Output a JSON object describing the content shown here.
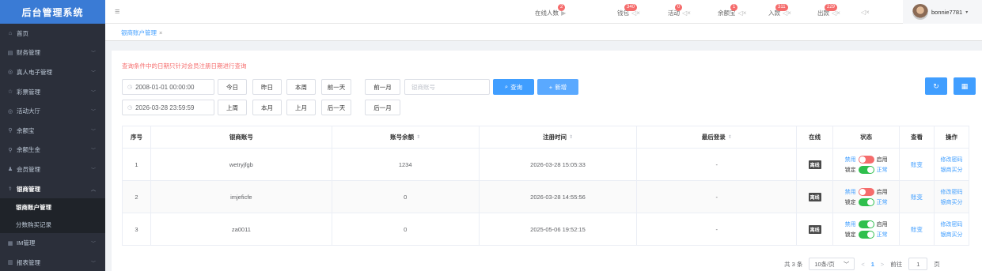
{
  "app": {
    "title": "后台管理系统"
  },
  "sidebar": {
    "items": [
      {
        "label": "首页",
        "icon": "home-icon",
        "glyph": "⌂"
      },
      {
        "label": "财务管理",
        "icon": "finance-icon",
        "glyph": "▤",
        "arrow": "﹀"
      },
      {
        "label": "真人电子管理",
        "icon": "casino-icon",
        "glyph": "◎",
        "arrow": "﹀"
      },
      {
        "label": "彩票管理",
        "icon": "star-icon",
        "glyph": "☆",
        "arrow": "﹀"
      },
      {
        "label": "活动大厅",
        "icon": "activity-icon",
        "glyph": "◎",
        "arrow": "﹀"
      },
      {
        "label": "余额宝",
        "icon": "location-icon",
        "glyph": "⚲",
        "arrow": "﹀"
      },
      {
        "label": "余额生金",
        "icon": "location-icon",
        "glyph": "⚲",
        "arrow": "﹀"
      },
      {
        "label": "会员管理",
        "icon": "user-icon",
        "glyph": "♟",
        "arrow": "﹀"
      },
      {
        "label": "银商管理",
        "icon": "merchant-icon",
        "glyph": "⚕",
        "arrow": "︿"
      }
    ],
    "subitems": [
      {
        "label": "银商账户管理"
      },
      {
        "label": "分数购买记录"
      }
    ],
    "items_after": [
      {
        "label": "IM管理",
        "icon": "im-icon",
        "glyph": "▦",
        "arrow": "﹀"
      },
      {
        "label": "报表管理",
        "icon": "report-icon",
        "glyph": "▥",
        "arrow": "﹀"
      }
    ]
  },
  "topbar": {
    "hamburger": "≡",
    "items": [
      {
        "label": "在线人数",
        "badge": "2",
        "suffix": "▶"
      },
      {
        "label": "钱包",
        "badge": "340",
        "suffix": "◁×"
      },
      {
        "label": "活动",
        "badge": "0",
        "suffix": "◁×"
      },
      {
        "label": "余额宝",
        "badge": "1",
        "suffix": "◁×"
      },
      {
        "label": "入款",
        "badge": "311",
        "suffix": "◁×"
      },
      {
        "label": "出款",
        "badge": "229",
        "suffix": "◁×"
      },
      {
        "label": "",
        "badge": "",
        "suffix": "◁×"
      }
    ],
    "user": {
      "name": "bonnie7781",
      "caret": "▾"
    }
  },
  "tabs": [
    {
      "label": "银商账户管理",
      "close": "×"
    }
  ],
  "filters": {
    "hint": "查询条件中的日期只针对会员注册日期进行查询",
    "start_date": "2008-01-01 00:00:00",
    "end_date": "2026-03-28 23:59:59",
    "row1_buttons": [
      "今日",
      "昨日",
      "本周",
      "前一天",
      "前一月"
    ],
    "row2_buttons": [
      "上周",
      "本月",
      "上月",
      "后一天",
      "后一月"
    ],
    "account_placeholder": "银商账号",
    "search_label": "查询",
    "add_label": "新增",
    "clock_glyph": "◷",
    "search_glyph": "⌕",
    "add_glyph": "+",
    "refresh_glyph": "↻",
    "grid_glyph": "▦"
  },
  "table": {
    "headers": [
      "序号",
      "银商账号",
      "账号余额",
      "注册时间",
      "最后登录",
      "在线",
      "状态",
      "查看",
      "操作"
    ],
    "sort_glyph": "⇕",
    "rows": [
      {
        "index": "1",
        "account": "wetryjfgb",
        "balance": "1234",
        "registered": "2026-03-28 15:05:33",
        "last_login": "-",
        "online": "离线",
        "ban_on": false,
        "lock_on": true,
        "view": "账变",
        "op1": "修改密码",
        "op2": "银商买分"
      },
      {
        "index": "2",
        "account": "imjeficfe",
        "balance": "0",
        "registered": "2026-03-28 14:55:56",
        "last_login": "-",
        "online": "离线",
        "ban_on": false,
        "lock_on": true,
        "view": "账变",
        "op1": "修改密码",
        "op2": "银商买分"
      },
      {
        "index": "3",
        "account": "za0011",
        "balance": "0",
        "registered": "2025-05-06 19:52:15",
        "last_login": "-",
        "online": "离线",
        "ban_on": true,
        "lock_on": true,
        "view": "账变",
        "op1": "修改密码",
        "op2": "银商买分"
      }
    ],
    "status_labels": {
      "ban": "禁用",
      "enable": "启用",
      "lock": "锁定",
      "normal": "正常"
    }
  },
  "pagination": {
    "total": "共 3 条",
    "page_size": "10条/页",
    "prev": "<",
    "current": "1",
    "next": ">",
    "goto_label": "前往",
    "goto_value": "1",
    "page_unit": "页"
  },
  "colors": {
    "accent": "#409eff",
    "danger": "#f56c6c",
    "success": "#2fbf4d",
    "sidebar": "#2b2f3a"
  }
}
